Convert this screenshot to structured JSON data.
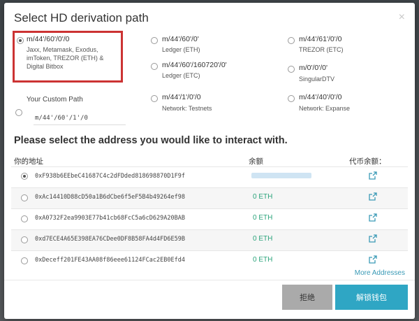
{
  "modal": {
    "title": "Select HD derivation path",
    "close_glyph": "×"
  },
  "paths": [
    {
      "path": "m/44'/60'/0'/0",
      "description": "Jaxx, Metamask, Exodus, imToken, TREZOR (ETH) & Digital Bitbox",
      "selected": true
    },
    {
      "path": "m/44'/60'/0'",
      "description": "Ledger (ETH)",
      "selected": false
    },
    {
      "path": "m/44'/61'/0'/0",
      "description": "TREZOR (ETC)",
      "selected": false
    },
    {
      "path": "m/44'/60'/160720'/0'",
      "description": "Ledger (ETC)",
      "selected": false
    },
    {
      "path": "m/0'/0'/0'",
      "description": "SingularDTV",
      "selected": false
    },
    {
      "path": "m/44'/1'/0'/0",
      "description": "Network: Testnets",
      "selected": false
    },
    {
      "path": "m/44'/40'/0'/0",
      "description": "Network: Expanse",
      "selected": false
    }
  ],
  "custom_path": {
    "label": "Your Custom Path",
    "value": "m/44'/60'/1'/0"
  },
  "addresses_section": {
    "title": "Please select the address you would like to interact with.",
    "col_address": "你的地址",
    "col_balance": "余额",
    "col_token_balance": "代币余额："
  },
  "addresses": [
    {
      "address": "0xF938b6EEbeC41687C4c2dFDded818698870D1F9f",
      "balance": "",
      "selected": true
    },
    {
      "address": "0xAc14410D88cD50a1B6dCbe6f5eF5B4b49264ef98",
      "balance": "0 ETH",
      "selected": false
    },
    {
      "address": "0xA0732F2ea9903E77b41cb68FcC5a6cD629A20BAB",
      "balance": "0 ETH",
      "selected": false
    },
    {
      "address": "0xd7ECE4A65E398EA76CDee0DF8B58FA4d4FD6E59B",
      "balance": "0 ETH",
      "selected": false
    },
    {
      "address": "0xDeceff201FE43AA08f86eee61124FCac2EB0Efd4",
      "balance": "0 ETH",
      "selected": false
    }
  ],
  "more_addresses_label": "More Addresses",
  "buttons": {
    "reject": "拒绝",
    "unlock": "解锁钱包"
  },
  "colors": {
    "accent": "#2fa6c4",
    "highlight_border": "#cc3333",
    "balance_green": "#2aa37a"
  },
  "icons": {
    "external_link": "external-link-icon",
    "close": "close-icon"
  }
}
